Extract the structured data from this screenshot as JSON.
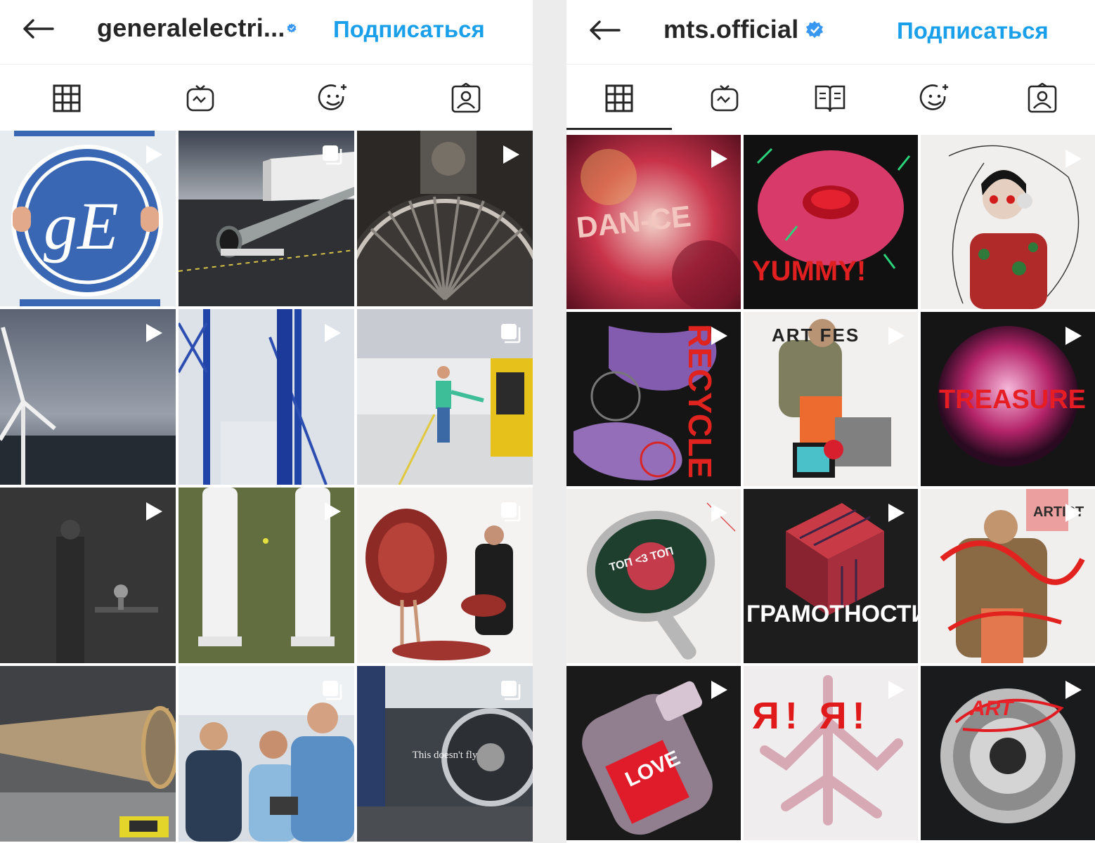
{
  "left": {
    "header": {
      "username": "generalelectri...",
      "follow_label": "Подписаться",
      "verified": true
    },
    "tabs": [
      "grid-icon",
      "igtv-icon",
      "effects-icon",
      "tagged-icon"
    ],
    "posts": [
      {
        "badge": "video",
        "text": "gE"
      },
      {
        "badge": "carousel"
      },
      {
        "badge": "video"
      },
      {
        "badge": "video"
      },
      {
        "badge": "video"
      },
      {
        "badge": "carousel"
      },
      {
        "badge": "video"
      },
      {
        "badge": "video"
      },
      {
        "badge": "carousel"
      },
      {
        "badge": "none"
      },
      {
        "badge": "carousel"
      },
      {
        "badge": "carousel",
        "caption": "This doesn't fly"
      }
    ]
  },
  "right": {
    "header": {
      "username": "mts.official",
      "follow_label": "Подписаться",
      "verified": true
    },
    "tabs": [
      "grid-icon",
      "igtv-icon",
      "guides-icon",
      "effects-icon",
      "tagged-icon"
    ],
    "posts": [
      {
        "badge": "video",
        "text": "DAN-CE"
      },
      {
        "badge": "none",
        "text": "YUMMY!"
      },
      {
        "badge": "video"
      },
      {
        "badge": "video",
        "text": "RECYCLE"
      },
      {
        "badge": "video",
        "text": "ART FES"
      },
      {
        "badge": "video",
        "text": "TREASURE"
      },
      {
        "badge": "video",
        "text": "ТОП <3 ТОП"
      },
      {
        "badge": "video",
        "text": "ГРАМОТНОСТИ"
      },
      {
        "badge": "video",
        "text": "ARTIST"
      },
      {
        "badge": "video",
        "text": "LOVE"
      },
      {
        "badge": "video",
        "text": "Я! Я!"
      },
      {
        "badge": "video",
        "text": "ART"
      }
    ]
  },
  "colors": {
    "accent": "#1aa0ea",
    "text": "#262626",
    "verified": "#3897f0"
  }
}
